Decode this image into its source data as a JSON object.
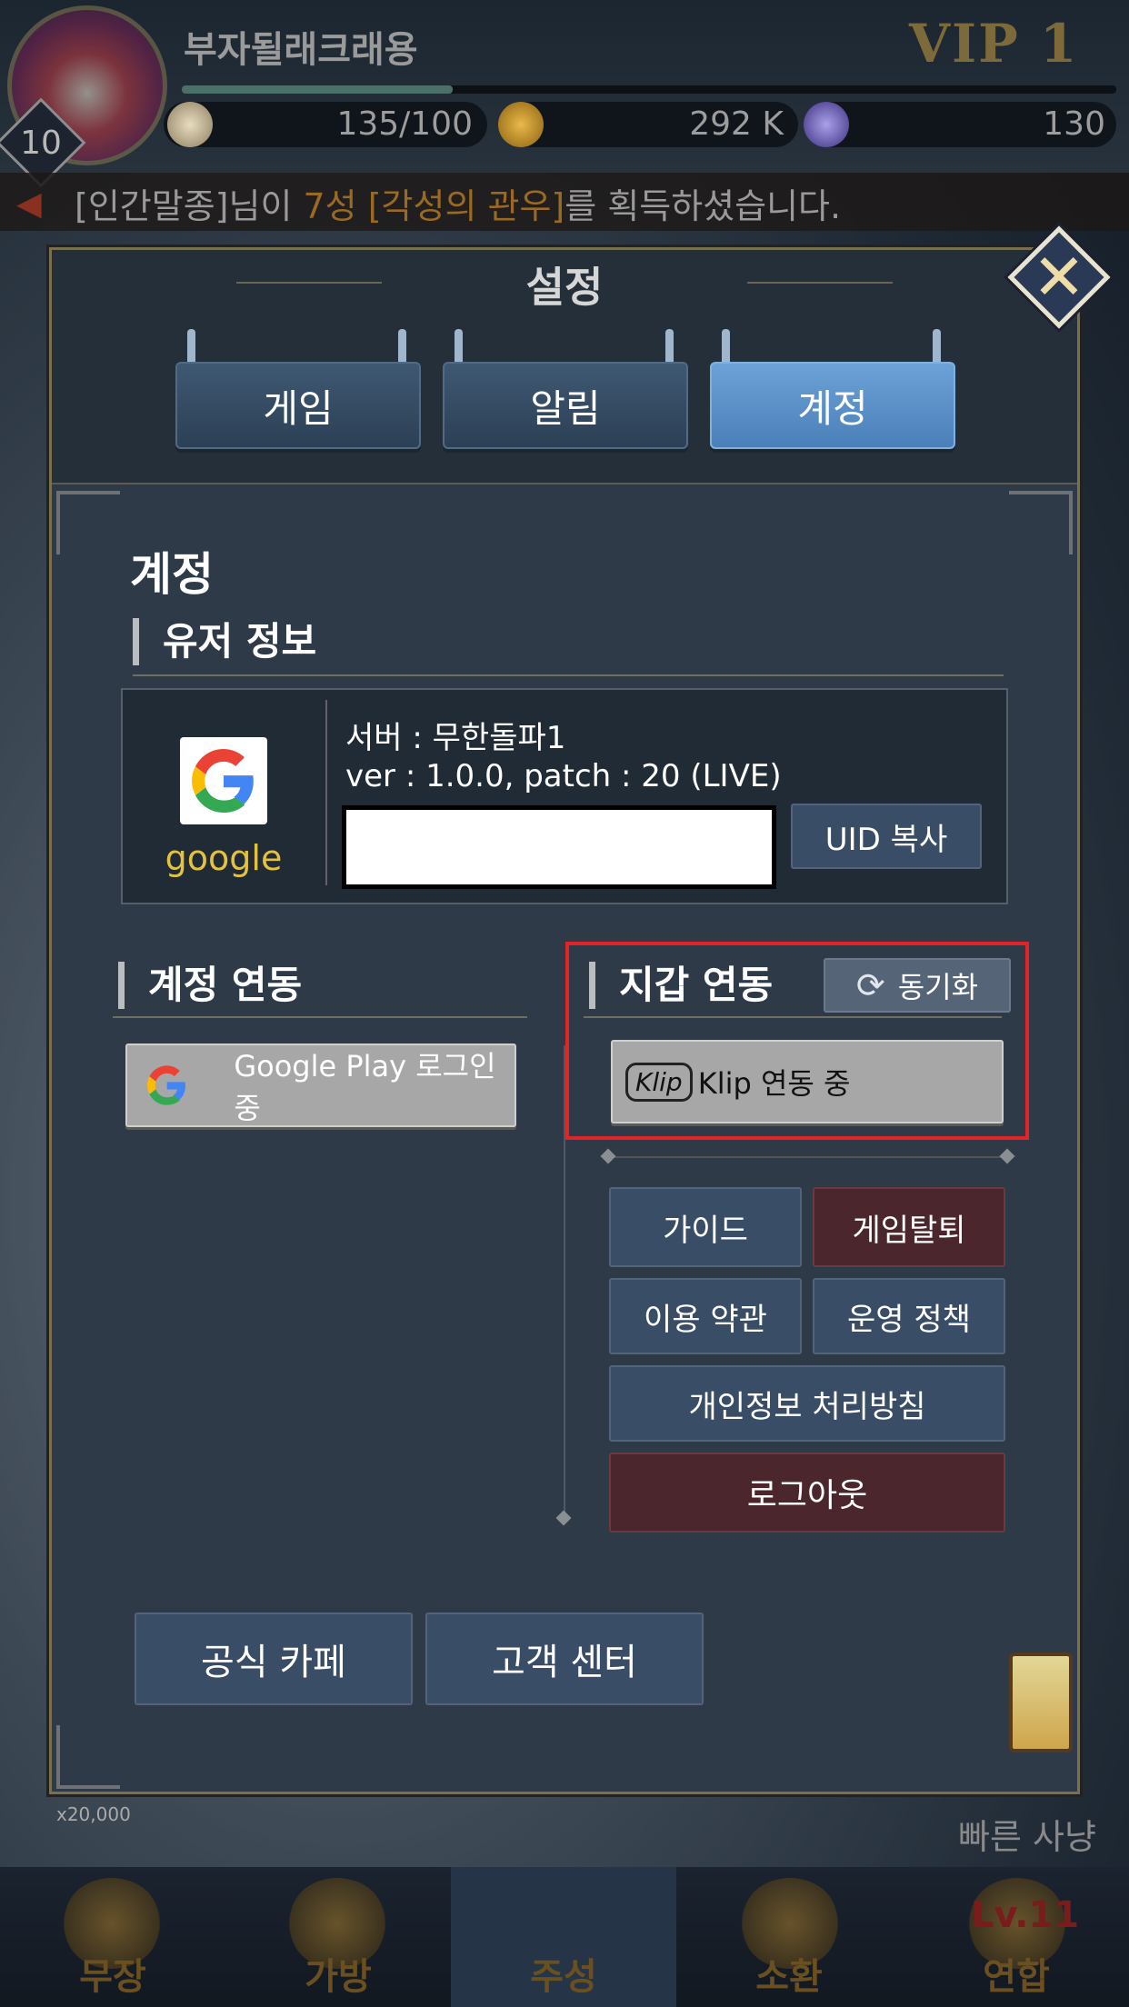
{
  "hud": {
    "player_name": "부자될래크래용",
    "vip": "VIP 1",
    "level": "10",
    "xp_fraction": 0.29,
    "stamina": "135/100",
    "gold": "292 K",
    "gems": "130"
  },
  "ticker": {
    "pre": "[인간말종]님이 ",
    "star": "7성 ",
    "item": "[각성의 관우]",
    "post": "를 획득하셨습니다."
  },
  "modal": {
    "title": "설정",
    "tabs": [
      {
        "label": "게임"
      },
      {
        "label": "알림"
      },
      {
        "label": "계정"
      }
    ],
    "active_tab": "계정",
    "section_title": "계정",
    "user_info": {
      "heading": "유저 정보",
      "provider": "google",
      "server": "서버 : 무한돌파1",
      "version": "ver : 1.0.0, patch : 20 (LIVE)",
      "uid_copy": "UID 복사"
    },
    "account_link": {
      "heading": "계정 연동",
      "google_button": "Google Play 로그인 중"
    },
    "wallet_link": {
      "heading": "지갑 연동",
      "sync_button": "동기화",
      "klip_badge": "Klip",
      "klip_button": "Klip 연동 중"
    },
    "buttons": {
      "guide": "가이드",
      "withdraw": "게임탈퇴",
      "terms": "이용 약관",
      "policy": "운영 정책",
      "privacy": "개인정보 처리방침",
      "logout": "로그아웃"
    },
    "footer": {
      "cafe": "공식 카페",
      "support": "고객 센터"
    }
  },
  "bg": {
    "fast_hunt": "빠른 사냥",
    "price": "x20,000"
  },
  "nav": [
    {
      "label": "무장"
    },
    {
      "label": "가방"
    },
    {
      "label": "주성"
    },
    {
      "label": "소환"
    },
    {
      "label": "연합"
    }
  ],
  "nav_badge": "Lv.11",
  "colors": {
    "accent": "#4a7fb8",
    "highlight": "#e4222a",
    "danger": "#4b272d"
  }
}
